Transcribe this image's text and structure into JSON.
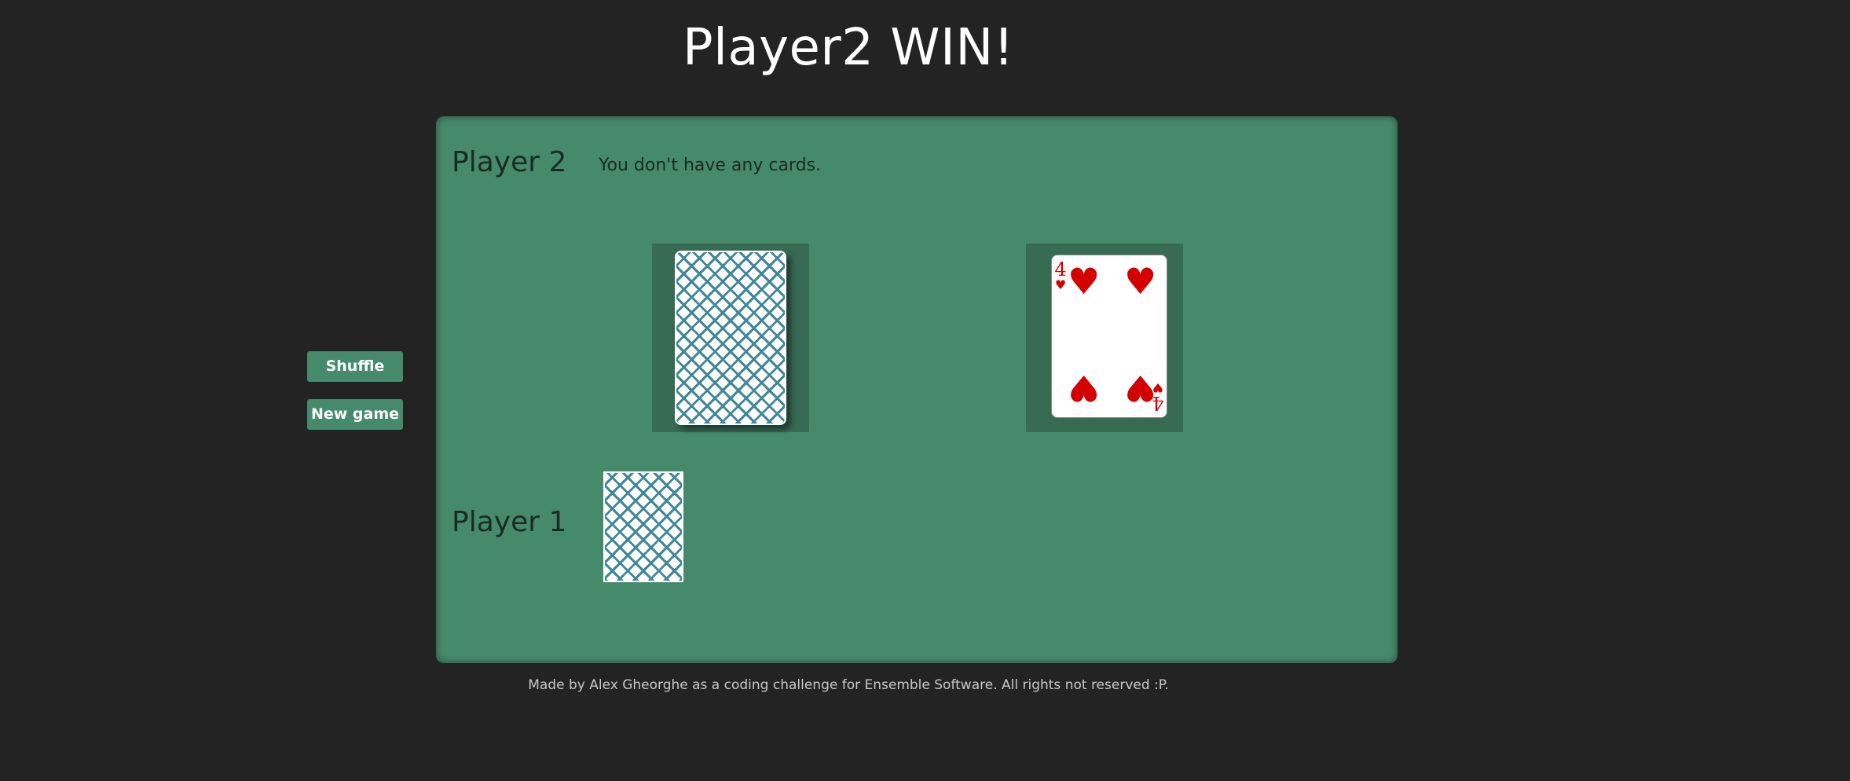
{
  "title": "Player2 WIN!",
  "buttons": {
    "shuffle": "Shuffle",
    "new_game": "New game"
  },
  "table": {
    "player2": {
      "label": "Player 2",
      "message": "You don't have any cards."
    },
    "player1": {
      "label": "Player 1"
    },
    "face_card": {
      "rank": "4",
      "suit": "♥",
      "suit_name": "heart-suit",
      "color": "#d40000"
    }
  },
  "colors": {
    "background": "#232323",
    "table": "#468a6c",
    "slot": "#376b54",
    "button": "#458a6c",
    "card_back_pattern": "#3f8799"
  },
  "footer": "Made by Alex Gheorghe as a coding challenge for Ensemble Software. All rights not reserved :P."
}
